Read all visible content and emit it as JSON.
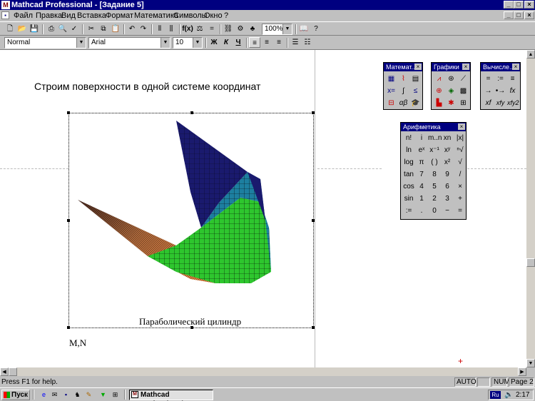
{
  "window": {
    "title": "Mathcad Professional - [Задание 5]",
    "app_icon_glyph": "M",
    "controls": [
      "_",
      "□",
      "×"
    ],
    "doc_controls": [
      "_",
      "□",
      "×"
    ]
  },
  "menu": [
    {
      "label": "Файл",
      "key": "menu-file"
    },
    {
      "label": "Правка",
      "key": "menu-edit"
    },
    {
      "label": "Вид",
      "key": "menu-view"
    },
    {
      "label": "Вставка",
      "key": "menu-insert"
    },
    {
      "label": "Формат",
      "key": "menu-format"
    },
    {
      "label": "Математика",
      "key": "menu-math"
    },
    {
      "label": "Символы",
      "key": "menu-symbolics"
    },
    {
      "label": "Окно",
      "key": "menu-window"
    },
    {
      "label": "?",
      "key": "menu-help"
    }
  ],
  "toolbar": {
    "zoom": "100%",
    "style": "Normal",
    "font": "Arial",
    "size": "10",
    "bold": "Ж",
    "italic": "К",
    "underline": "Ч"
  },
  "document": {
    "heading": "Строим поверхности в одной системе координат",
    "plot_caption": "Параболический цилиндр",
    "plot_variables": "M,N"
  },
  "palettes": {
    "math": {
      "title": "Математ...",
      "icons": [
        "calculator-icon",
        "graph-icon",
        "matrix-icon",
        "evaluation-icon",
        "calculus-icon",
        "boolean-icon",
        "programming-icon",
        "greek-icon",
        "symbolic-icon"
      ]
    },
    "graphs": {
      "title": "Графики",
      "icons": [
        "xy-plot-icon",
        "polar-plot-icon",
        "surface-plot-icon",
        "polar-icon",
        "contour-plot-icon",
        "3d-scatter-icon",
        "3d-bar-icon",
        "vector-field-icon",
        "3d-plot-wizard-icon"
      ]
    },
    "evaluation": {
      "title": "Вычисле...",
      "keys": [
        "=",
        ":=",
        "≡",
        "→",
        "•→",
        "fx",
        "xf",
        "xfy",
        "xfy2"
      ]
    },
    "arithmetic": {
      "title": "Арифметика",
      "rows": [
        [
          "n!",
          "i",
          "m..n",
          "xn",
          "|x|"
        ],
        [
          "ln",
          "eˣ",
          "x⁻¹",
          "xʸ",
          "ⁿ√"
        ],
        [
          "log",
          "π",
          "( )",
          "x²",
          "√"
        ],
        [
          "tan",
          "7",
          "8",
          "9",
          "/"
        ],
        [
          "cos",
          "4",
          "5",
          "6",
          "×"
        ],
        [
          "sin",
          "1",
          "2",
          "3",
          "+"
        ],
        [
          ":=",
          ".",
          "0",
          "−",
          "="
        ]
      ]
    }
  },
  "status": {
    "help": "Press F1 for help.",
    "mode": "AUTO",
    "num": "NUM",
    "page": "Page 2"
  },
  "taskbar": {
    "start": "Пуск",
    "app_button": "Mathcad Professional...",
    "lang": "Ru",
    "clock": "2:17"
  },
  "colors": {
    "titlebar": "#000080",
    "surface_top": "#1a1a6e",
    "surface_mid": "#1d7fa0",
    "surface_low": "#2ec62e",
    "surface_edge": "#b06a3c"
  }
}
